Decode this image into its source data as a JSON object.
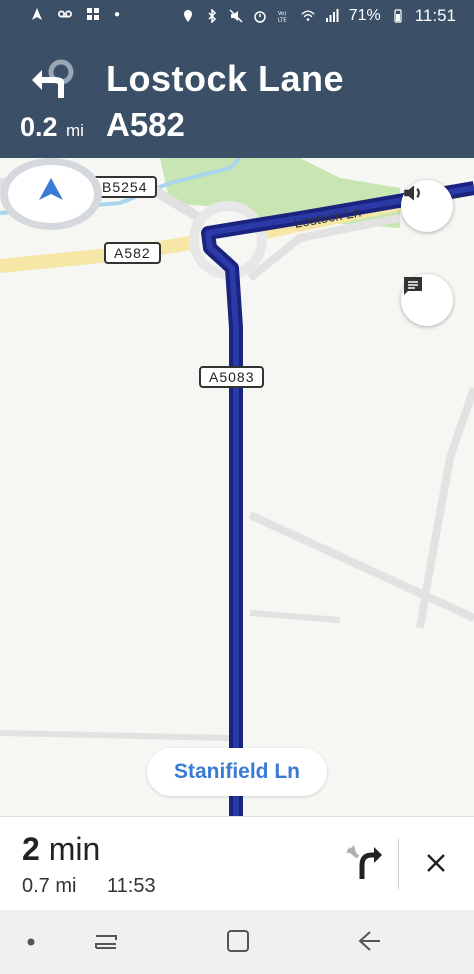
{
  "status_bar": {
    "battery": "71%",
    "time": "11:51"
  },
  "nav_header": {
    "distance_value": "0.2",
    "distance_unit": "mi",
    "street_name": "Lostock Lane",
    "road_number": "A582",
    "maneuver_icon": "roundabout-left-icon"
  },
  "map": {
    "road_labels": [
      "B5254",
      "A582",
      "A5083"
    ],
    "street_on_map": "Lostock Ln",
    "current_street": "Stanifield Ln",
    "buttons": [
      "volume-icon",
      "report-icon"
    ],
    "colors": {
      "route": "#1a237e",
      "header_bg": "#3b5066",
      "current_location": "#3a7bd5",
      "park": "#c8e6b4",
      "major_road": "#f7e7a6"
    }
  },
  "bottom_bar": {
    "eta_minutes_value": "2",
    "eta_minutes_unit": "min",
    "remaining_distance": "0.7 mi",
    "arrival_time": "11:53"
  }
}
